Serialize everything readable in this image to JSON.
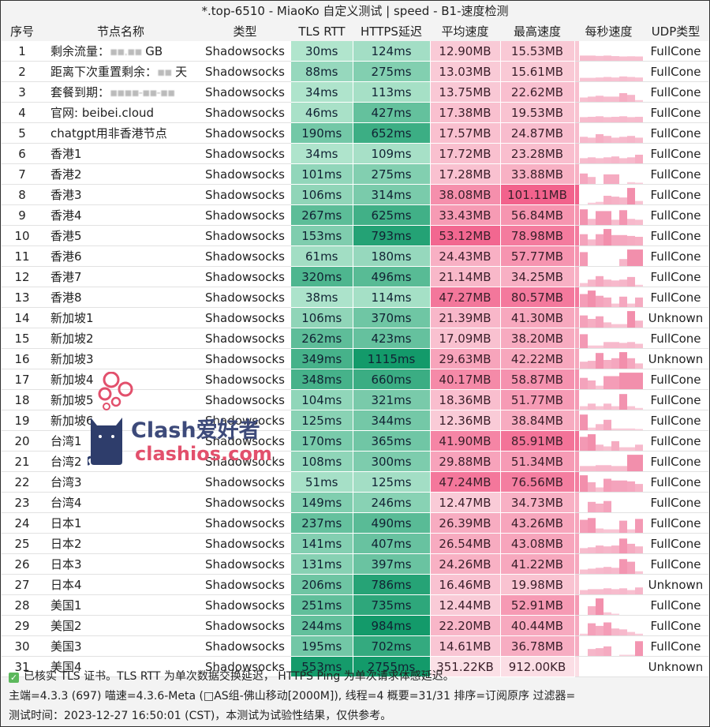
{
  "window": {
    "title": "*.top-6510 - MiaoKo 自定义测试 | speed - B1-速度检测"
  },
  "table": {
    "headers": {
      "idx": "序号",
      "name": "节点名称",
      "type": "类型",
      "tls": "TLS RTT",
      "https": "HTTPS延迟",
      "avg": "平均速度",
      "max": "最高速度",
      "spark": "每秒速度",
      "udp": "UDP类型"
    },
    "rows": [
      {
        "idx": "1",
        "name": "剩余流量：",
        "name_blur": "▪▪.▪▪",
        "name_suffix": " GB",
        "type": "Shadowsocks",
        "tls": "30ms",
        "https": "124ms",
        "avg": "12.90MB",
        "max": "15.53MB",
        "udp": "FullCone",
        "tls_v": 30,
        "https_v": 124,
        "avg_v": 12.9,
        "max_v": 15.53,
        "spark": [
          0.3,
          0.3,
          0.28,
          0.3,
          0.27,
          0.25,
          0.26,
          0.25
        ]
      },
      {
        "idx": "2",
        "name": "距离下次重置剩余：",
        "name_blur": "▪▪",
        "name_suffix": " 天",
        "type": "Shadowsocks",
        "tls": "88ms",
        "https": "275ms",
        "avg": "13.03MB",
        "max": "15.61MB",
        "udp": "FullCone",
        "tls_v": 88,
        "https_v": 275,
        "avg_v": 13.03,
        "max_v": 15.61,
        "spark": [
          0.2,
          0.2,
          0.22,
          0.25,
          0.22,
          0.28,
          0.25,
          0.22
        ]
      },
      {
        "idx": "3",
        "name": "套餐到期：",
        "name_blur": "▪▪▪▪-▪▪-▪▪",
        "name_suffix": "",
        "type": "Shadowsocks",
        "tls": "34ms",
        "https": "113ms",
        "avg": "13.75MB",
        "max": "22.62MB",
        "udp": "FullCone",
        "tls_v": 34,
        "https_v": 113,
        "avg_v": 13.75,
        "max_v": 22.62,
        "spark": [
          0.25,
          0.3,
          0.35,
          0.3,
          0.3,
          0.5,
          0.4,
          0.1
        ]
      },
      {
        "idx": "4",
        "name": "官网: beibei.cloud",
        "name_blur": "",
        "name_suffix": "",
        "type": "Shadowsocks",
        "tls": "46ms",
        "https": "427ms",
        "avg": "17.38MB",
        "max": "19.53MB",
        "udp": "FullCone",
        "tls_v": 46,
        "https_v": 427,
        "avg_v": 17.38,
        "max_v": 19.53,
        "spark": [
          0.3,
          0.32,
          0.35,
          0.3,
          0.32,
          0.35,
          0.3,
          0.32
        ]
      },
      {
        "idx": "5",
        "name": "chatgpt用非香港节点",
        "name_blur": "",
        "name_suffix": "",
        "type": "Shadowsocks",
        "tls": "190ms",
        "https": "652ms",
        "avg": "17.57MB",
        "max": "24.87MB",
        "udp": "FullCone",
        "tls_v": 190,
        "https_v": 652,
        "avg_v": 17.57,
        "max_v": 24.87,
        "spark": [
          0.35,
          0.3,
          0.5,
          0.4,
          0.3,
          0.35,
          0.4,
          0.3
        ]
      },
      {
        "idx": "6",
        "name": "香港1",
        "name_blur": "",
        "name_suffix": "",
        "type": "Shadowsocks",
        "tls": "34ms",
        "https": "109ms",
        "avg": "17.72MB",
        "max": "23.28MB",
        "udp": "FullCone",
        "tls_v": 34,
        "https_v": 109,
        "avg_v": 17.72,
        "max_v": 23.28,
        "spark": [
          0.3,
          0.35,
          0.3,
          0.35,
          0.4,
          0.3,
          0.35,
          0.5
        ]
      },
      {
        "idx": "7",
        "name": "香港2",
        "name_blur": "",
        "name_suffix": "",
        "type": "Shadowsocks",
        "tls": "101ms",
        "https": "275ms",
        "avg": "17.28MB",
        "max": "33.88MB",
        "udp": "FullCone",
        "tls_v": 101,
        "https_v": 275,
        "avg_v": 17.28,
        "max_v": 33.88,
        "spark": [
          0.6,
          0.4,
          0,
          0.55,
          0.55,
          0,
          0.1,
          0.05
        ]
      },
      {
        "idx": "8",
        "name": "香港3",
        "name_blur": "",
        "name_suffix": "",
        "type": "Shadowsocks",
        "tls": "106ms",
        "https": "314ms",
        "avg": "38.08MB",
        "max": "101.11MB",
        "udp": "FullCone",
        "tls_v": 106,
        "https_v": 314,
        "avg_v": 38.08,
        "max_v": 101.11,
        "spark": [
          0,
          0.1,
          0.15,
          0.5,
          0.45,
          0.4,
          0.95,
          0.2
        ]
      },
      {
        "idx": "9",
        "name": "香港4",
        "name_blur": "",
        "name_suffix": "",
        "type": "Shadowsocks",
        "tls": "267ms",
        "https": "625ms",
        "avg": "33.43MB",
        "max": "56.84MB",
        "udp": "FullCone",
        "tls_v": 267,
        "https_v": 625,
        "avg_v": 33.43,
        "max_v": 56.84,
        "spark": [
          0.9,
          0.35,
          0.8,
          0.8,
          0.3,
          0.85,
          0.35,
          0.3
        ]
      },
      {
        "idx": "10",
        "name": "香港5",
        "name_blur": "",
        "name_suffix": "",
        "type": "Shadowsocks",
        "tls": "153ms",
        "https": "793ms",
        "avg": "53.12MB",
        "max": "78.98MB",
        "udp": "FullCone",
        "tls_v": 153,
        "https_v": 793,
        "avg_v": 53.12,
        "max_v": 78.98,
        "spark": [
          0.65,
          0.35,
          0.65,
          0.95,
          0.6,
          0.6,
          0.55,
          0.5
        ]
      },
      {
        "idx": "11",
        "name": "香港6",
        "name_blur": "",
        "name_suffix": "",
        "type": "Shadowsocks",
        "tls": "61ms",
        "https": "180ms",
        "avg": "24.43MB",
        "max": "57.77MB",
        "udp": "FullCone",
        "tls_v": 61,
        "https_v": 180,
        "avg_v": 24.43,
        "max_v": 57.77,
        "spark": [
          0.8,
          0,
          0,
          0,
          0,
          0.4,
          0.95,
          0.95
        ]
      },
      {
        "idx": "12",
        "name": "香港7",
        "name_blur": "",
        "name_suffix": "",
        "type": "Shadowsocks",
        "tls": "320ms",
        "https": "496ms",
        "avg": "21.14MB",
        "max": "34.25MB",
        "udp": "FullCone",
        "tls_v": 320,
        "https_v": 496,
        "avg_v": 21.14,
        "max_v": 34.25,
        "spark": [
          0.2,
          0.4,
          0.6,
          0.4,
          0.35,
          0.4,
          0.55,
          0.1
        ]
      },
      {
        "idx": "13",
        "name": "香港8",
        "name_blur": "",
        "name_suffix": "",
        "type": "Shadowsocks",
        "tls": "38ms",
        "https": "114ms",
        "avg": "47.27MB",
        "max": "80.57MB",
        "udp": "FullCone",
        "tls_v": 38,
        "https_v": 114,
        "avg_v": 47.27,
        "max_v": 80.57,
        "spark": [
          0.75,
          0.95,
          0.65,
          0.55,
          0.2,
          0.6,
          0.2,
          0.55
        ]
      },
      {
        "idx": "14",
        "name": "新加坡1",
        "name_blur": "",
        "name_suffix": "",
        "type": "Shadowsocks",
        "tls": "106ms",
        "https": "370ms",
        "avg": "21.39MB",
        "max": "41.30MB",
        "udp": "Unknown",
        "tls_v": 106,
        "https_v": 370,
        "avg_v": 21.39,
        "max_v": 41.3,
        "spark": [
          0.7,
          0.5,
          0.65,
          0.3,
          0.2,
          0.2,
          0.95,
          0.4
        ]
      },
      {
        "idx": "15",
        "name": "新加坡2",
        "name_blur": "",
        "name_suffix": "",
        "type": "Shadowsocks",
        "tls": "262ms",
        "https": "423ms",
        "avg": "17.09MB",
        "max": "38.20MB",
        "udp": "FullCone",
        "tls_v": 262,
        "https_v": 423,
        "avg_v": 17.09,
        "max_v": 38.2,
        "spark": [
          0.8,
          0.15,
          0.15,
          0.35,
          0.35,
          0.3,
          0.35,
          0.25
        ]
      },
      {
        "idx": "16",
        "name": "新加坡3",
        "name_blur": "",
        "name_suffix": "",
        "type": "Shadowsocks",
        "tls": "349ms",
        "https": "1115ms",
        "avg": "29.63MB",
        "max": "42.22MB",
        "udp": "Unknown",
        "tls_v": 349,
        "https_v": 1115,
        "avg_v": 29.63,
        "max_v": 42.22,
        "spark": [
          0.4,
          0.45,
          0.9,
          0.5,
          0.6,
          0.95,
          0.6,
          0.3
        ]
      },
      {
        "idx": "17",
        "name": "新加坡4",
        "name_blur": "",
        "name_suffix": "",
        "type": "Shadowsocks",
        "tls": "348ms",
        "https": "660ms",
        "avg": "40.17MB",
        "max": "58.87MB",
        "udp": "FullCone",
        "tls_v": 348,
        "https_v": 660,
        "avg_v": 40.17,
        "max_v": 58.87,
        "spark": [
          0.65,
          0.5,
          0.2,
          0.75,
          0.75,
          0.95,
          0.95,
          0.95
        ]
      },
      {
        "idx": "18",
        "name": "新加坡5",
        "name_blur": "",
        "name_suffix": "",
        "type": "Shadowsocks",
        "tls": "104ms",
        "https": "321ms",
        "avg": "18.36MB",
        "max": "51.77MB",
        "udp": "FullCone",
        "tls_v": 104,
        "https_v": 321,
        "avg_v": 18.36,
        "max_v": 51.77,
        "spark": [
          0.2,
          0.35,
          0.2,
          0.35,
          0.2,
          0.9,
          0.2,
          0.1
        ]
      },
      {
        "idx": "19",
        "name": "新加坡6",
        "name_blur": "",
        "name_suffix": "",
        "type": "Shadowsocks",
        "tls": "125ms",
        "https": "344ms",
        "avg": "12.36MB",
        "max": "38.84MB",
        "udp": "FullCone",
        "tls_v": 125,
        "https_v": 344,
        "avg_v": 12.36,
        "max_v": 38.84,
        "spark": [
          0.9,
          0.15,
          0.35,
          0.6,
          0.1,
          0.1,
          0.1,
          0.05
        ]
      },
      {
        "idx": "20",
        "name": "台湾1",
        "name_blur": "",
        "name_suffix": "",
        "type": "Shadowsocks",
        "tls": "170ms",
        "https": "365ms",
        "avg": "41.90MB",
        "max": "85.91MB",
        "udp": "FullCone",
        "tls_v": 170,
        "https_v": 365,
        "avg_v": 41.9,
        "max_v": 85.91,
        "spark": [
          0.8,
          0.95,
          0.35,
          0.25,
          0.55,
          0.2,
          0.2,
          0.35
        ]
      },
      {
        "idx": "21",
        "name": "台湾2",
        "name_blur": "",
        "name_suffix": "",
        "type": "Shadowsocks",
        "tls": "108ms",
        "https": "300ms",
        "avg": "29.88MB",
        "max": "51.34MB",
        "udp": "FullCone",
        "tls_v": 108,
        "https_v": 300,
        "avg_v": 29.88,
        "max_v": 51.34,
        "spark": [
          0.3,
          0.3,
          0.35,
          0.35,
          0.3,
          0.3,
          0.95,
          0.95
        ]
      },
      {
        "idx": "22",
        "name": "台湾3",
        "name_blur": "",
        "name_suffix": "",
        "type": "Shadowsocks",
        "tls": "51ms",
        "https": "125ms",
        "avg": "47.24MB",
        "max": "76.56MB",
        "udp": "FullCone",
        "tls_v": 51,
        "https_v": 125,
        "avg_v": 47.24,
        "max_v": 76.56,
        "spark": [
          0.95,
          0.55,
          0.25,
          0.75,
          0.65,
          0.65,
          0.6,
          0.45
        ]
      },
      {
        "idx": "23",
        "name": "台湾4",
        "name_blur": "",
        "name_suffix": "",
        "type": "Shadowsocks",
        "tls": "149ms",
        "https": "246ms",
        "avg": "12.47MB",
        "max": "34.73MB",
        "udp": "FullCone",
        "tls_v": 149,
        "https_v": 246,
        "avg_v": 12.47,
        "max_v": 34.73,
        "spark": [
          0,
          0.6,
          0.5,
          0.65,
          0,
          0,
          0,
          0
        ]
      },
      {
        "idx": "24",
        "name": "日本1",
        "name_blur": "",
        "name_suffix": "",
        "type": "Shadowsocks",
        "tls": "237ms",
        "https": "490ms",
        "avg": "26.39MB",
        "max": "43.26MB",
        "udp": "FullCone",
        "tls_v": 237,
        "https_v": 490,
        "avg_v": 26.39,
        "max_v": 43.26,
        "spark": [
          0.75,
          0.85,
          0.25,
          0.2,
          0.2,
          0.7,
          0.2,
          0.8
        ]
      },
      {
        "idx": "25",
        "name": "日本2",
        "name_blur": "",
        "name_suffix": "",
        "type": "Shadowsocks",
        "tls": "141ms",
        "https": "407ms",
        "avg": "26.54MB",
        "max": "43.08MB",
        "udp": "FullCone",
        "tls_v": 141,
        "https_v": 407,
        "avg_v": 26.54,
        "max_v": 43.08,
        "spark": [
          0.3,
          0.35,
          0.45,
          0.4,
          0.45,
          0.85,
          0.55,
          0.4
        ]
      },
      {
        "idx": "26",
        "name": "日本3",
        "name_blur": "",
        "name_suffix": "",
        "type": "Shadowsocks",
        "tls": "131ms",
        "https": "397ms",
        "avg": "24.26MB",
        "max": "41.22MB",
        "udp": "FullCone",
        "tls_v": 131,
        "https_v": 397,
        "avg_v": 24.26,
        "max_v": 41.22,
        "spark": [
          0.25,
          0.3,
          0.35,
          0.4,
          0.35,
          0.85,
          0.7,
          0.15
        ]
      },
      {
        "idx": "27",
        "name": "日本4",
        "name_blur": "",
        "name_suffix": "",
        "type": "Shadowsocks",
        "tls": "206ms",
        "https": "786ms",
        "avg": "16.46MB",
        "max": "19.98MB",
        "udp": "Unknown",
        "tls_v": 206,
        "https_v": 786,
        "avg_v": 16.46,
        "max_v": 19.98,
        "spark": [
          0.25,
          0.3,
          0.3,
          0.35,
          0.3,
          0.35,
          0.25,
          0.4
        ]
      },
      {
        "idx": "28",
        "name": "美国1",
        "name_blur": "",
        "name_suffix": "",
        "type": "Shadowsocks",
        "tls": "251ms",
        "https": "735ms",
        "avg": "12.44MB",
        "max": "52.91MB",
        "udp": "FullCone",
        "tls_v": 251,
        "https_v": 735,
        "avg_v": 12.44,
        "max_v": 52.91,
        "spark": [
          0,
          0.5,
          0.95,
          0.15,
          0.05,
          0,
          0,
          0
        ]
      },
      {
        "idx": "29",
        "name": "美国2",
        "name_blur": "",
        "name_suffix": "",
        "type": "Shadowsocks",
        "tls": "244ms",
        "https": "984ms",
        "avg": "22.20MB",
        "max": "40.44MB",
        "udp": "FullCone",
        "tls_v": 244,
        "https_v": 984,
        "avg_v": 22.2,
        "max_v": 40.44,
        "spark": [
          0.1,
          0.7,
          0.55,
          0.75,
          0.4,
          0.35,
          0.2,
          0.1
        ]
      },
      {
        "idx": "30",
        "name": "美国3",
        "name_blur": "",
        "name_suffix": "",
        "type": "Shadowsocks",
        "tls": "195ms",
        "https": "702ms",
        "avg": "14.61MB",
        "max": "36.78MB",
        "udp": "FullCone",
        "tls_v": 195,
        "https_v": 702,
        "avg_v": 14.61,
        "max_v": 36.78,
        "spark": [
          0,
          0.4,
          0.45,
          0.55,
          0,
          0.05,
          0.05,
          0.85
        ]
      },
      {
        "idx": "31",
        "name": "美国4",
        "name_blur": "",
        "name_suffix": "",
        "type": "Shadowsocks",
        "tls": "553ms",
        "https": "2755ms",
        "avg": "351.22KB",
        "max": "912.00KB",
        "udp": "Unknown",
        "tls_v": 553,
        "https_v": 2755,
        "avg_v": 0.34,
        "max_v": 0.89,
        "spark": [
          0,
          0,
          0,
          0,
          0,
          0,
          0,
          0
        ]
      }
    ]
  },
  "footer": {
    "line1": "已核实 TLS 证书。TLS RTT 为单次数据交换延迟， HTTPS Ping 为单次请求体感延迟。",
    "line2": "主端=4.3.3 (697) 喵速=4.3.6-Meta (□AS组-佛山移动[2000M]), 线程=4 概要=31/31 排序=订阅原序 过滤器=",
    "line3": "测试时间：2023-12-27 16:50:01 (CST)，本测试为试验性结果，仅供参考。"
  },
  "watermark": {
    "text1": "Clash爱好者",
    "text2": "clashios.com"
  },
  "colors": {
    "green_light": "#c8f0dc",
    "green_dark": "#139a6a",
    "pink_light": "#fbe0e6",
    "pink_dark": "#f2628c",
    "spark": "#f07ea0"
  }
}
